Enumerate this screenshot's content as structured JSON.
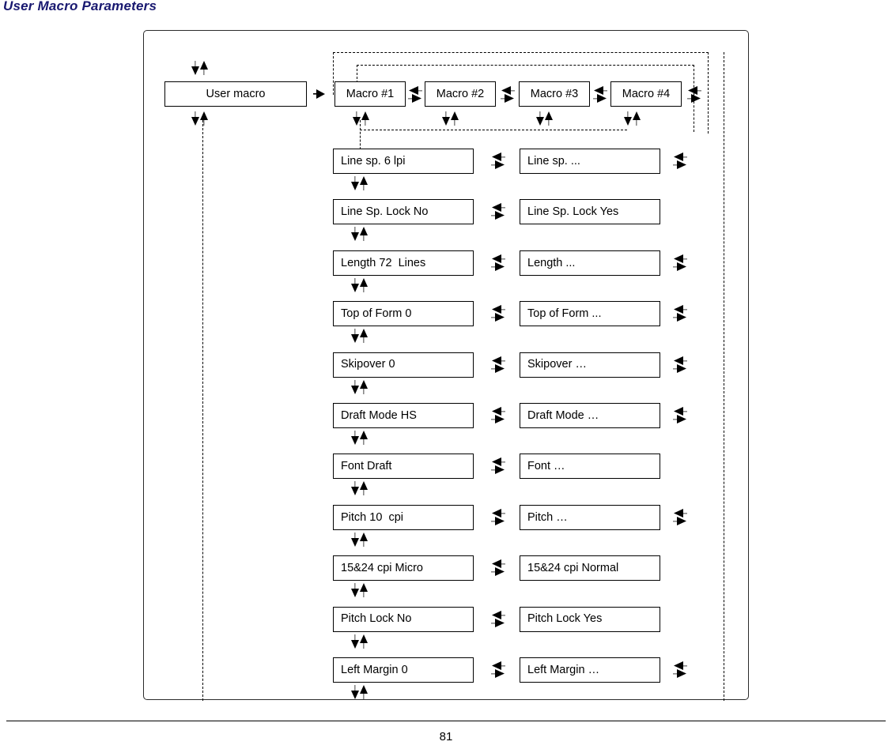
{
  "page": {
    "title": "User Macro Parameters",
    "page_number": "81",
    "title_color": "#191970"
  },
  "top_row": {
    "root": {
      "label": "User macro"
    },
    "macros": [
      {
        "label": "Macro #1"
      },
      {
        "label": "Macro #2"
      },
      {
        "label": "Macro #3"
      },
      {
        "label": "Macro #4"
      }
    ]
  },
  "parameters": [
    {
      "current": "Line sp. 6 lpi",
      "option": "Line sp. ...",
      "option_has_next": true
    },
    {
      "current": "Line Sp. Lock No",
      "option": "Line Sp. Lock Yes",
      "option_has_next": false
    },
    {
      "current": "Length 72  Lines",
      "option": "Length ...",
      "option_has_next": true
    },
    {
      "current": "Top of Form 0",
      "option": "Top of Form ...",
      "option_has_next": true
    },
    {
      "current": "Skipover 0",
      "option": "Skipover …",
      "option_has_next": true
    },
    {
      "current": "Draft Mode HS",
      "option": "Draft Mode …",
      "option_has_next": true
    },
    {
      "current": "Font Draft",
      "option": "Font …",
      "option_has_next": false
    },
    {
      "current": "Pitch 10  cpi",
      "option": "Pitch …",
      "option_has_next": true
    },
    {
      "current": "15&24 cpi Micro",
      "option": "15&24 cpi Normal",
      "option_has_next": false
    },
    {
      "current": "Pitch Lock No",
      "option": "Pitch Lock Yes",
      "option_has_next": false
    },
    {
      "current": "Left Margin 0",
      "option": "Left Margin …",
      "option_has_next": true
    }
  ],
  "icons": {
    "up_down": "up-down-arrow-pair-icon",
    "left_right": "left-right-arrow-pair-icon",
    "right": "right-arrow-icon"
  }
}
